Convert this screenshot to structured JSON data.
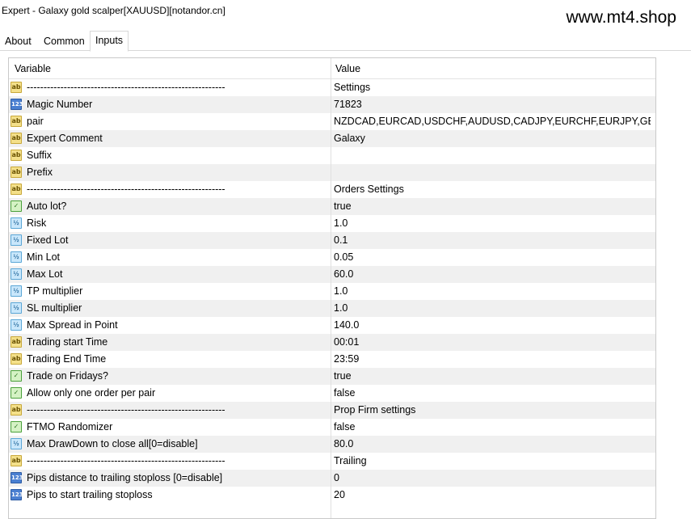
{
  "window": {
    "title": "Expert - Galaxy  gold scalper[XAUUSD][notandor.cn]",
    "watermark": "www.mt4.shop"
  },
  "tabs": [
    {
      "label": "About"
    },
    {
      "label": "Common"
    },
    {
      "label": "Inputs",
      "active": true
    }
  ],
  "table": {
    "headers": {
      "variable": "Variable",
      "value": "Value"
    },
    "rows": [
      {
        "icon": "ab",
        "variable": "-----------------------------------------------------------",
        "value": "Settings"
      },
      {
        "icon": "123",
        "variable": "Magic Number",
        "value": "71823"
      },
      {
        "icon": "ab",
        "variable": "pair",
        "value": "NZDCAD,EURCAD,USDCHF,AUDUSD,CADJPY,EURCHF,EURJPY,GBP..."
      },
      {
        "icon": "ab",
        "variable": "Expert Comment",
        "value": "Galaxy"
      },
      {
        "icon": "ab",
        "variable": "Suffix",
        "value": ""
      },
      {
        "icon": "ab",
        "variable": "Prefix",
        "value": ""
      },
      {
        "icon": "ab",
        "variable": "-----------------------------------------------------------",
        "value": "Orders Settings"
      },
      {
        "icon": "bool",
        "variable": "Auto lot?",
        "value": "true"
      },
      {
        "icon": "v2",
        "variable": "Risk",
        "value": "1.0"
      },
      {
        "icon": "v2",
        "variable": "Fixed Lot",
        "value": "0.1"
      },
      {
        "icon": "v2",
        "variable": "Min Lot",
        "value": "0.05"
      },
      {
        "icon": "v2",
        "variable": "Max Lot",
        "value": "60.0"
      },
      {
        "icon": "v2",
        "variable": "TP multiplier",
        "value": "1.0"
      },
      {
        "icon": "v2",
        "variable": "SL multiplier",
        "value": "1.0"
      },
      {
        "icon": "v2",
        "variable": "Max Spread in Point",
        "value": "140.0"
      },
      {
        "icon": "ab",
        "variable": "Trading start Time",
        "value": "00:01"
      },
      {
        "icon": "ab",
        "variable": "Trading End Time",
        "value": "23:59"
      },
      {
        "icon": "bool",
        "variable": "Trade on Fridays?",
        "value": "true"
      },
      {
        "icon": "bool",
        "variable": "Allow only one order per pair",
        "value": "false"
      },
      {
        "icon": "ab",
        "variable": "-----------------------------------------------------------",
        "value": "Prop Firm settings"
      },
      {
        "icon": "bool",
        "variable": "FTMO Randomizer",
        "value": "false"
      },
      {
        "icon": "v2",
        "variable": "Max DrawDown to close all[0=disable]",
        "value": "80.0"
      },
      {
        "icon": "ab",
        "variable": "-----------------------------------------------------------",
        "value": "Trailing"
      },
      {
        "icon": "123",
        "variable": "Pips distance to trailing stoploss [0=disable]",
        "value": "0"
      },
      {
        "icon": "123",
        "variable": "Pips to start trailing stoploss",
        "value": "20"
      }
    ]
  }
}
